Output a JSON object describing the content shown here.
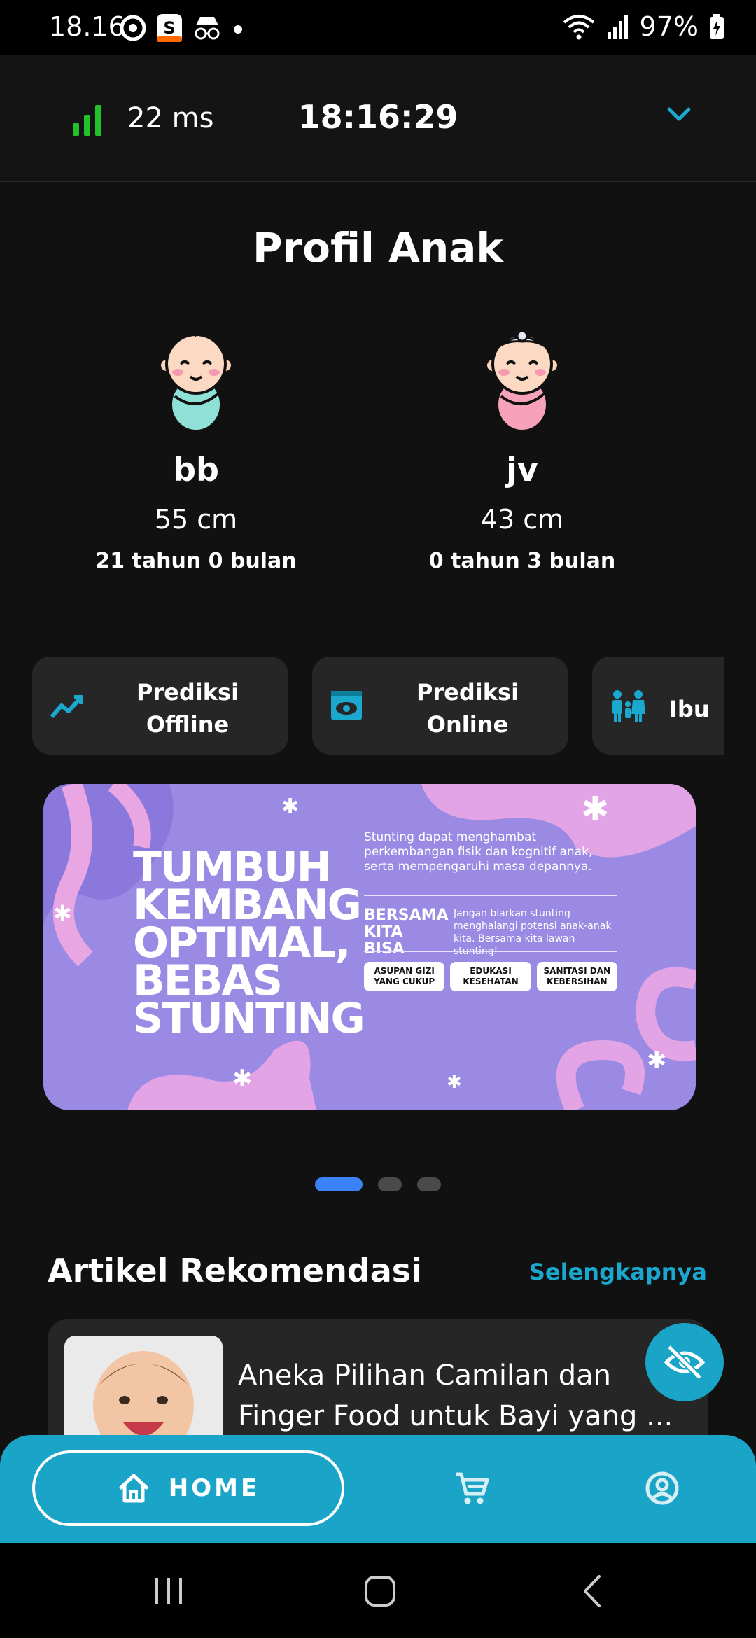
{
  "status_bar": {
    "time": "18.16",
    "battery": "97%"
  },
  "network": {
    "latency": "22 ms",
    "clock": "18:16:29"
  },
  "profile": {
    "title": "Profil Anak",
    "children": [
      {
        "name": "bb",
        "height": "55 cm",
        "age": "21 tahun 0 bulan"
      },
      {
        "name": "jv",
        "height": "43 cm",
        "age": "0 tahun 3 bulan"
      }
    ]
  },
  "actions": [
    {
      "label": "Prediksi\nOffline",
      "icon": "trend-icon"
    },
    {
      "label": "Prediksi\nOnline",
      "icon": "eye-box-icon"
    },
    {
      "label": "Ibu",
      "icon": "family-icon"
    }
  ],
  "banner": {
    "headline": [
      "TUMBUH",
      "KEMBANG",
      "OPTIMAL,",
      "BEBAS",
      "STUNTING"
    ],
    "intro": "Stunting dapat menghambat perkembangan fisik dan kognitif anak, serta mempengaruhi masa depannya.",
    "slogan": "BERSAMA KITA BISA",
    "slogan_text": "Jangan biarkan stunting menghalangi potensi anak-anak kita. Bersama kita lawan stunting!",
    "pills": [
      "ASUPAN GIZI YANG CUKUP",
      "EDUKASI KESEHATAN",
      "SANITASI DAN KEBERSIHAN"
    ],
    "slides_total": 3,
    "active_slide": 1
  },
  "articles": {
    "title": "Artikel Rekomendasi",
    "more": "Selengkapnya",
    "items": [
      {
        "title": "Aneka Pilihan Camilan dan Finger Food untuk Bayi yang ..."
      }
    ]
  },
  "nav": {
    "home": "HOME"
  },
  "colors": {
    "accent": "#1aa4c8",
    "background": "#111111",
    "card": "#262626",
    "signal": "#22c32a",
    "dot_active": "#3b82f6"
  }
}
